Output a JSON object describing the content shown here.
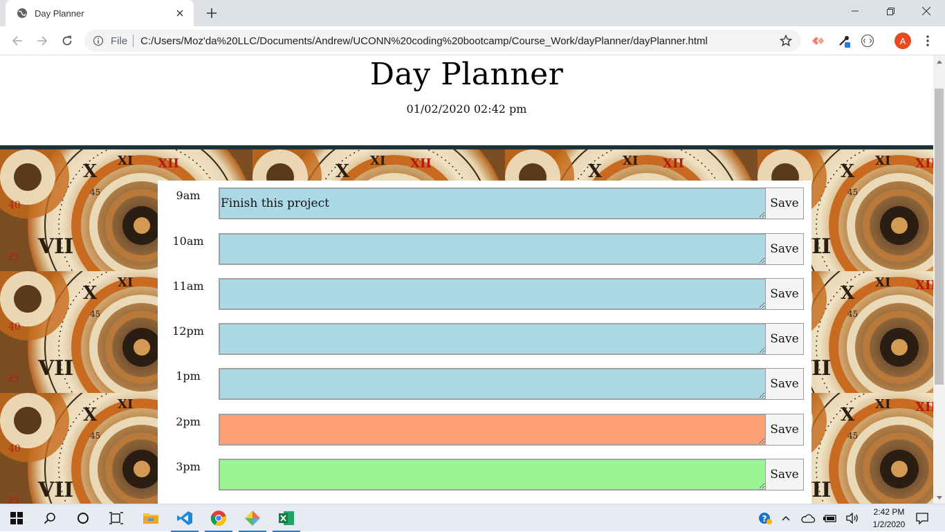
{
  "browser": {
    "tab_title": "Day Planner",
    "url_scheme": "File",
    "url": "C:/Users/Moz'da%20LLC/Documents/Andrew/UCONN%20coding%20bootcamp/Course_Work/dayPlanner/dayPlanner.html",
    "profile_initial": "A",
    "icons": [
      "globe-icon",
      "close-icon",
      "plus-icon",
      "minimize-icon",
      "restore-icon",
      "window-close-icon",
      "back-icon",
      "forward-icon",
      "reload-icon",
      "info-icon",
      "star-icon",
      "extension-icon",
      "eyedropper-icon",
      "extension-circle-icon",
      "menu-dots-icon"
    ]
  },
  "page": {
    "title": "Day Planner",
    "current_datetime": "01/02/2020 02:42 pm",
    "rows": [
      {
        "hour": "9am",
        "text": "Finish this project",
        "status": "past",
        "save_label": "Save"
      },
      {
        "hour": "10am",
        "text": "",
        "status": "past",
        "save_label": "Save"
      },
      {
        "hour": "11am",
        "text": "",
        "status": "past",
        "save_label": "Save"
      },
      {
        "hour": "12pm",
        "text": "",
        "status": "past",
        "save_label": "Save"
      },
      {
        "hour": "1pm",
        "text": "",
        "status": "past",
        "save_label": "Save"
      },
      {
        "hour": "2pm",
        "text": "",
        "status": "present",
        "save_label": "Save"
      },
      {
        "hour": "3pm",
        "text": "",
        "status": "future",
        "save_label": "Save"
      }
    ],
    "colors": {
      "past": "#add8e6",
      "present": "#ff9f78",
      "future": "#9af593",
      "divider": "#1e3438"
    }
  },
  "taskbar": {
    "time": "2:42 PM",
    "date": "1/2/2020",
    "apps": [
      "windows-start-icon",
      "search-icon",
      "cortana-icon",
      "task-view-icon",
      "file-explorer-icon",
      "vscode-icon",
      "chrome-icon",
      "git-icon",
      "excel-icon"
    ]
  }
}
